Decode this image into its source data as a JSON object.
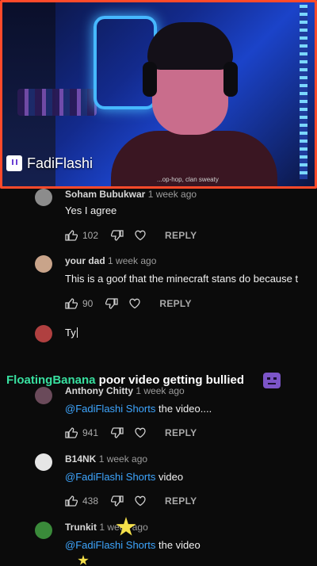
{
  "stream": {
    "streamer_name": "FadiFlashi",
    "chin_text": "...op-hop, clan sweaty"
  },
  "comments": [
    {
      "author": "Soham Bubukwar",
      "time": "1 week ago",
      "text": "Yes I agree",
      "likes": "102",
      "reply_label": "REPLY"
    },
    {
      "author": "your dad",
      "time": "1 week ago",
      "text": "This is a goof that the minecraft stans do because t",
      "likes": "90",
      "reply_label": "REPLY"
    },
    {
      "author": "Anthony Chitty",
      "time": "1 week ago",
      "mention": "@FadiFlashi Shorts",
      "text": " the video....",
      "likes": "941",
      "reply_label": "REPLY"
    },
    {
      "author": "B14NK",
      "time": "1 week ago",
      "mention": "@FadiFlashi Shorts",
      "text": " video",
      "likes": "438",
      "reply_label": "REPLY"
    },
    {
      "author": "Trunkit",
      "time": "1 week ago",
      "mention": "@FadiFlashi Shorts",
      "text": " the video"
    }
  ],
  "reply_input": {
    "value": "Ty"
  },
  "chat": {
    "username": "FloatingBanana",
    "message": " poor video getting bullied"
  },
  "colors": {
    "frame": "#ff4a2a",
    "mention": "#3ea6ff",
    "chat_user": "#38e0a0",
    "background": "#0b0b0b"
  },
  "icons": {
    "like": "thumb-up-icon",
    "dislike": "thumb-down-icon",
    "heart": "heart-icon",
    "platform": "twitch-icon",
    "emote": "chat-emote-icon"
  }
}
